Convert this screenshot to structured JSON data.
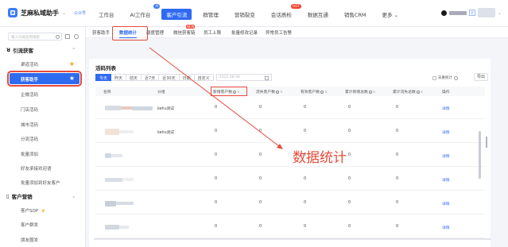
{
  "brand": {
    "name": "芝麻私域助手",
    "tag": "公众号"
  },
  "topnav": [
    {
      "label": "工作台",
      "active": false,
      "badge": ""
    },
    {
      "label": "AI工作台",
      "active": false,
      "badge": "AI"
    },
    {
      "label": "客户引流",
      "active": true,
      "badge": ""
    },
    {
      "label": "群管理",
      "active": false,
      "badge": ""
    },
    {
      "label": "营销裂变",
      "active": false,
      "badge": ""
    },
    {
      "label": "会话质检",
      "active": false,
      "badge": "HOT"
    },
    {
      "label": "数据互通",
      "active": false,
      "badge": ""
    },
    {
      "label": "销售CRM",
      "active": false,
      "badge": ""
    },
    {
      "label": "更多 ⌄",
      "active": false,
      "badge": ""
    }
  ],
  "sidebar": {
    "search_placeholder": "输入功能名称搜索",
    "groups": [
      {
        "label": "引流获客",
        "icon": "people-icon"
      },
      {
        "label": "客户营销",
        "icon": "document-icon"
      }
    ],
    "items": [
      {
        "label": "渠道活码",
        "star": true
      },
      {
        "label": "获客助手",
        "star": true,
        "selected": true
      },
      {
        "label": "企微活码"
      },
      {
        "label": "门店活码"
      },
      {
        "label": "城市活码"
      },
      {
        "label": "分流活码"
      },
      {
        "label": "批量添加"
      },
      {
        "label": "好友承接欢迎语"
      },
      {
        "label": "批量添加到好友客户"
      }
    ],
    "marketing_items": [
      {
        "label": "客户SOP"
      },
      {
        "label": "客户群发"
      },
      {
        "label": "朋友圈发"
      }
    ]
  },
  "tabs": [
    {
      "label": "获客助手",
      "active": false
    },
    {
      "label": "数据统计",
      "active": true
    },
    {
      "label": "额度管理",
      "active": false
    },
    {
      "label": "微信获客链",
      "active": false,
      "badge": "NEW"
    },
    {
      "label": "员工上限",
      "active": false
    },
    {
      "label": "批量修改记录",
      "active": false
    },
    {
      "label": "异常员工告警",
      "active": false
    }
  ],
  "panel": {
    "title": "活码列表",
    "filters": [
      "今天",
      "昨天",
      "前天",
      "近7天",
      "近30天",
      "日期",
      "自定义"
    ],
    "date_placeholder": "2025-08-08",
    "dedupe_label": "去重统计",
    "export_label": "导出"
  },
  "table": {
    "headers": [
      "名称",
      "分组",
      "新增客户数",
      "流失客户数",
      "有效客户数",
      "累计新增总数",
      "累计流失总数",
      "操作"
    ],
    "rows": [
      {
        "group": "kehu测试",
        "values": [
          "0",
          "0",
          "0",
          "0",
          "0"
        ],
        "action": "详情"
      },
      {
        "group": "kehu测试",
        "values": [
          "0",
          "0",
          "0",
          "0",
          "0"
        ],
        "action": "详情"
      },
      {
        "group": "",
        "values": [
          "0",
          "0",
          "0",
          "0",
          "0"
        ],
        "action": "详情"
      },
      {
        "group": "",
        "values": [
          "0",
          "0",
          "0",
          "0",
          "0"
        ],
        "action": "详情"
      },
      {
        "group": "",
        "values": [
          "0",
          "0",
          "0",
          "0",
          "0"
        ],
        "action": "详情"
      },
      {
        "group": "",
        "values": [
          "0",
          "0",
          "0",
          "0",
          "0"
        ],
        "action": "详情"
      }
    ]
  },
  "annotation": {
    "text": "数据统计",
    "color": "#e64a3b"
  },
  "colors": {
    "primary": "#2f6bf0",
    "highlight": "#e64a3b",
    "star": "#f7a21b"
  }
}
